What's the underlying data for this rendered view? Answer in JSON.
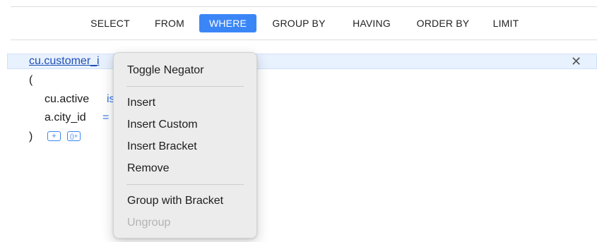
{
  "tabs": [
    {
      "label": "SELECT"
    },
    {
      "label": "FROM"
    },
    {
      "label": "WHERE",
      "active": true
    },
    {
      "label": "GROUP BY"
    },
    {
      "label": "HAVING"
    },
    {
      "label": "ORDER BY"
    },
    {
      "label": "LIMIT"
    }
  ],
  "editor": {
    "field_link": "cu.customer_i",
    "close_symbol": "✕",
    "open_paren": "(",
    "line1_field": "cu.active",
    "line1_op": "is",
    "line2_field": "a.city_id",
    "line2_op": "=",
    "close_paren": ")",
    "add_symbol": "+",
    "add_group_symbol": "()+"
  },
  "context_menu": {
    "items": [
      {
        "label": "Toggle Negator"
      },
      {
        "label": "Insert"
      },
      {
        "label": "Insert Custom"
      },
      {
        "label": "Insert Bracket"
      },
      {
        "label": "Remove"
      },
      {
        "label": "Group with Bracket"
      },
      {
        "label": "Ungroup",
        "disabled": true
      }
    ]
  },
  "colors": {
    "accent": "#3b86f7",
    "link": "#1f4fb5",
    "operator": "#2e72e6",
    "selected_row": "#e8f1fe",
    "menu_bg": "#ececec",
    "disabled_text": "#b3b3b3"
  }
}
